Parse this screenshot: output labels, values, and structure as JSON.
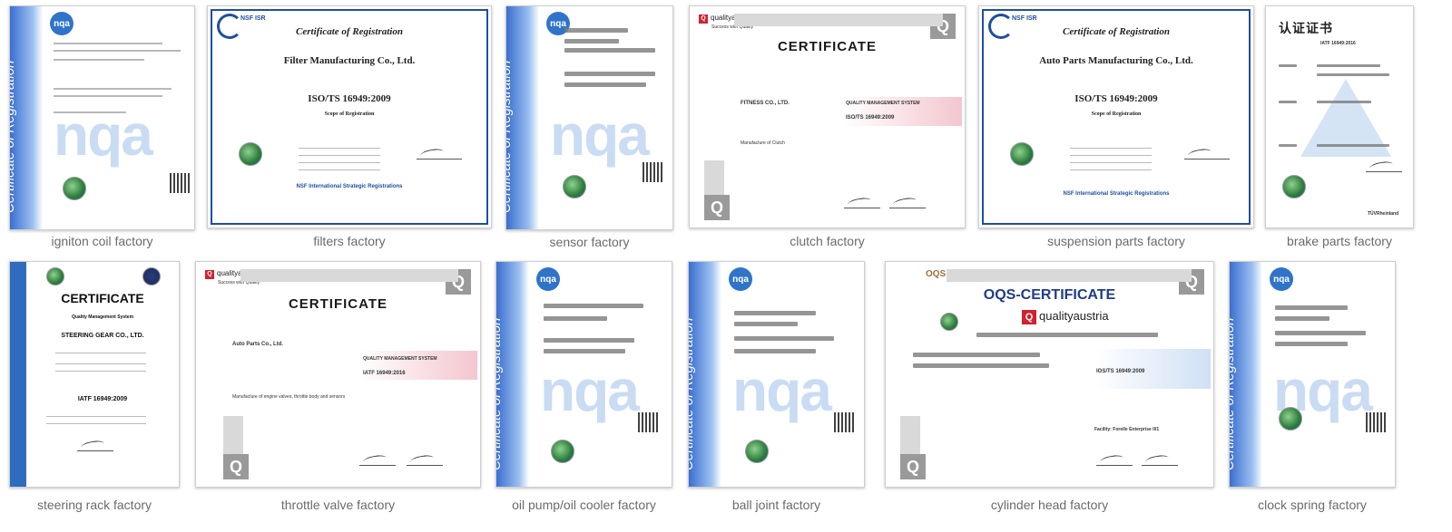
{
  "gallery": {
    "row1": [
      {
        "caption": "igniton coil factory",
        "type": "nqa",
        "band_text": "Certificate of Registration",
        "logo": "nqa",
        "watermark": "nqa"
      },
      {
        "caption": "filters factory",
        "type": "nsf",
        "logo": "NSF ISR",
        "title": "Certificate of Registration",
        "company": "Filter Manufacturing Co., Ltd.",
        "standard": "ISO/TS 16949:2009",
        "scope": "Scope of Registration",
        "footer": "NSF International Strategic Registrations"
      },
      {
        "caption": "sensor factory",
        "type": "nqa",
        "band_text": "Certificate of Registration",
        "logo": "nqa",
        "watermark": "nqa"
      },
      {
        "caption": "clutch factory",
        "type": "qa",
        "brand": "qualityaustria",
        "tagline": "Success with Quality",
        "title": "CERTIFICATE",
        "company": "FITNESS CO., LTD.",
        "system": "QUALITY MANAGEMENT SYSTEM",
        "standard": "ISO/TS 16949:2009",
        "scope": "Manufacture of Clutch"
      },
      {
        "caption": "suspension parts factory",
        "type": "nsf",
        "logo": "NSF ISR",
        "title": "Certificate of Registration",
        "company": "Auto Parts Manufacturing Co., Ltd.",
        "standard": "ISO/TS 16949:2009",
        "scope": "Scope of Registration",
        "footer": "NSF International Strategic Registrations"
      },
      {
        "caption": "brake parts factory",
        "type": "cn",
        "title": "认证证书",
        "standard": "IATF 16949:2016",
        "brand": "TÜVRheinland"
      }
    ],
    "row2": [
      {
        "caption": "steering rack factory",
        "type": "steering",
        "title": "CERTIFICATE",
        "system": "Quality Management System",
        "company": "STEERING GEAR CO., LTD.",
        "standard": "IATF 16949:2009"
      },
      {
        "caption": "throttle valve factory",
        "type": "qa",
        "brand": "qualityaustria",
        "tagline": "Success with Quality",
        "title": "CERTIFICATE",
        "company": "Auto Parts Co., Ltd.",
        "system": "QUALITY MANAGEMENT SYSTEM",
        "standard": "IATF 16949:2016",
        "scope": "Manufacture of engine valves, throttle body and sensors"
      },
      {
        "caption": "oil pump/oil cooler factory",
        "type": "nqa",
        "band_text": "Certificate of Registration",
        "logo": "nqa",
        "watermark": "nqa"
      },
      {
        "caption": "ball joint factory",
        "type": "nqa",
        "band_text": "Certificate of Registration",
        "logo": "nqa",
        "watermark": "nqa"
      },
      {
        "caption": "cylinder head factory",
        "type": "oqs",
        "brand": "OQS",
        "title": "OQS-CERTIFICATE",
        "qa_brand": "qualityaustria",
        "standard": "IOS/TS 16949:2009",
        "facility": "Facility: Forelle Enterprise II/1"
      },
      {
        "caption": "clock spring factory",
        "type": "nqa",
        "band_text": "Certificate of Registration",
        "logo": "nqa",
        "watermark": "nqa"
      }
    ]
  }
}
